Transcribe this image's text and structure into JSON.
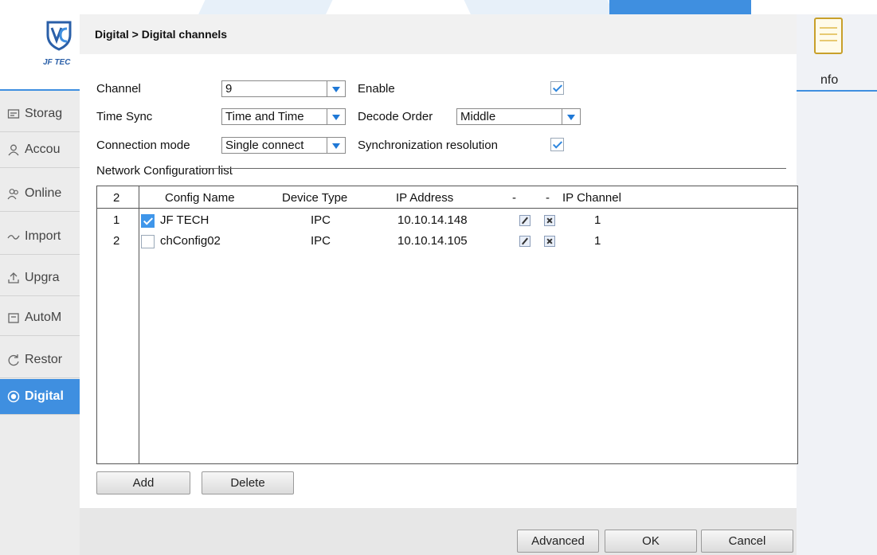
{
  "brand": {
    "logo_text": "JF TEC"
  },
  "sidebar": {
    "items": [
      {
        "label": "Storag",
        "icon": "storage-icon",
        "active": false
      },
      {
        "label": "Accou",
        "icon": "account-icon",
        "active": false
      },
      {
        "label": "Online",
        "icon": "online-user-icon",
        "active": false
      },
      {
        "label": "Import",
        "icon": "import-icon",
        "active": false
      },
      {
        "label": "Upgra",
        "icon": "upgrade-icon",
        "active": false
      },
      {
        "label": "AutoM",
        "icon": "auto-maintain-icon",
        "active": false
      },
      {
        "label": "Restor",
        "icon": "restore-icon",
        "active": false
      },
      {
        "label": "Digital",
        "icon": "digital-icon",
        "active": true
      }
    ]
  },
  "right_panel": {
    "label": "nfo",
    "icon": "info-document-icon"
  },
  "dialog": {
    "title": "Digital > Digital channels",
    "channel": {
      "label": "Channel",
      "value": "9"
    },
    "enable": {
      "label": "Enable",
      "checked": true
    },
    "time_sync": {
      "label": "Time Sync",
      "value": "Time and Time"
    },
    "decode_order": {
      "label": "Decode Order",
      "value": "Middle"
    },
    "connection_mode": {
      "label": "Connection mode",
      "value": "Single connect"
    },
    "sync_resolution": {
      "label": "Synchronization resolution",
      "checked": true
    },
    "network_list": {
      "label": "Network Configuration list",
      "count": "2",
      "headers": {
        "config_name": "Config Name",
        "device_type": "Device Type",
        "ip_address": "IP Address",
        "edit": "-",
        "delete": "-",
        "ip_channel": "IP Channel"
      },
      "rows": [
        {
          "index": "1",
          "checked": true,
          "config_name": "JF TECH",
          "device_type": "IPC",
          "ip_address": "10.10.14.148",
          "ip_channel": "1"
        },
        {
          "index": "2",
          "checked": false,
          "config_name": "chConfig02",
          "device_type": "IPC",
          "ip_address": "10.10.14.105",
          "ip_channel": "1"
        }
      ]
    },
    "buttons": {
      "add": "Add",
      "delete": "Delete",
      "advanced": "Advanced",
      "ok": "OK",
      "cancel": "Cancel"
    }
  },
  "colors": {
    "accent": "#3f8fe0",
    "dialog_bg": "#e7e7e7",
    "sidebar_bg": "#ececec"
  }
}
